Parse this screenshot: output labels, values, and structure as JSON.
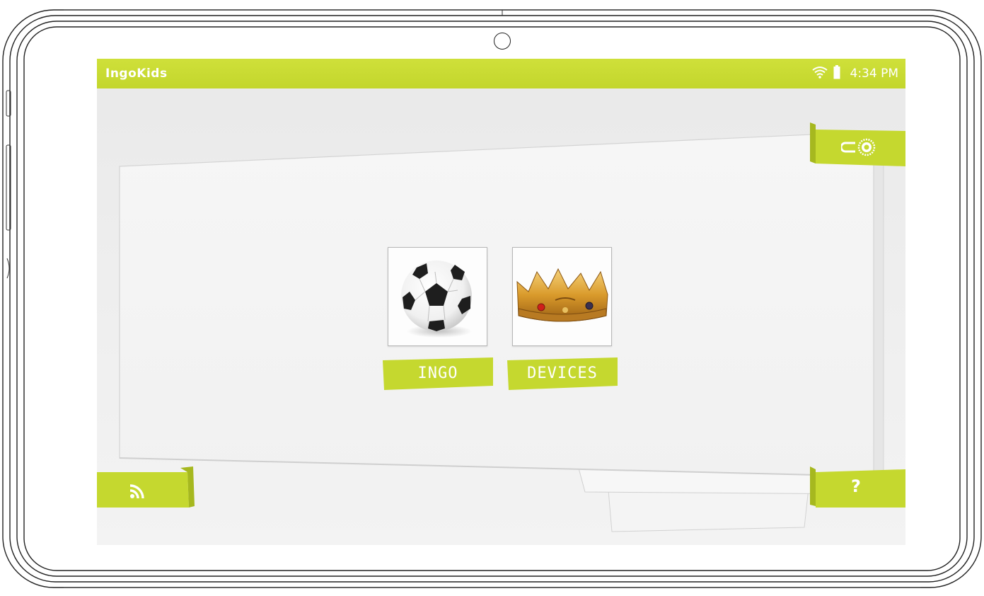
{
  "status_bar": {
    "app_name": "IngoKids",
    "time": "4:34 PM",
    "icons": [
      "wifi-icon",
      "battery-icon"
    ]
  },
  "tiles": [
    {
      "label": "INGO",
      "icon": "soccer-ball-icon"
    },
    {
      "label": "DEVICES",
      "icon": "crown-icon"
    }
  ],
  "buttons": {
    "top_right_icon": "key-gear-icon",
    "bottom_left_icon": "rss-feed-icon",
    "help_label": "?"
  },
  "colors": {
    "accent": "#c5d82f",
    "accent_dark": "#a6b81f",
    "background": "#eeeeee"
  }
}
